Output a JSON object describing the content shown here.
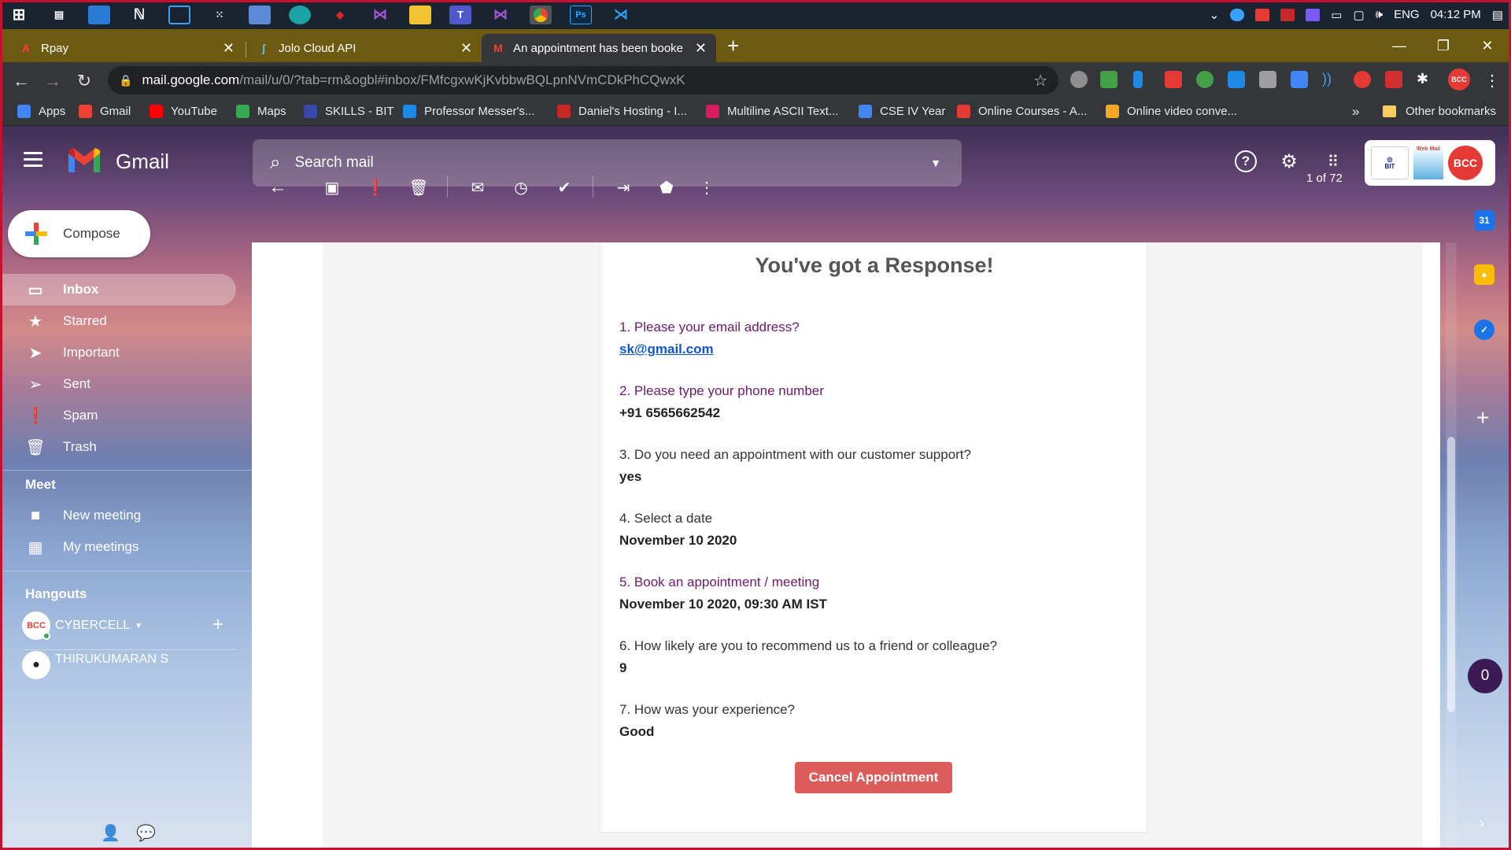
{
  "taskbar": {
    "lang": "ENG",
    "time": "04:12 PM"
  },
  "tabs": [
    {
      "title": "Rpay"
    },
    {
      "title": "Jolo Cloud API"
    },
    {
      "title": "An appointment has been booke"
    }
  ],
  "omnibox": {
    "host": "mail.google.com",
    "path": "/mail/u/0/?tab=rm&ogbl#inbox/FMfcgxwKjKvbbwBQLpnNVmCDkPhCQwxK"
  },
  "bookmarks": {
    "items": [
      {
        "label": "Apps",
        "color": "#4285f4"
      },
      {
        "label": "Gmail",
        "color": "#ea4335"
      },
      {
        "label": "YouTube",
        "color": "#ff0000"
      },
      {
        "label": "Maps",
        "color": "#34a853"
      },
      {
        "label": "SKILLS - BIT",
        "color": "#3949ab"
      },
      {
        "label": "Professor Messer's...",
        "color": "#1e88e5"
      },
      {
        "label": "Daniel's Hosting - I...",
        "color": "#c62828"
      },
      {
        "label": "Multiline ASCII Text...",
        "color": "#d81b60"
      },
      {
        "label": "CSE IV Year",
        "color": "#4285f4"
      },
      {
        "label": "Online Courses - A...",
        "color": "#e53935"
      },
      {
        "label": "Online video conve...",
        "color": "#f9a825"
      }
    ],
    "more": "»",
    "other": "Other bookmarks"
  },
  "gmail": {
    "product_name": "Gmail",
    "search_placeholder": "Search mail",
    "compose": "Compose",
    "nav": [
      {
        "label": "Inbox",
        "icon": "inbox-icon"
      },
      {
        "label": "Starred",
        "icon": "star-icon"
      },
      {
        "label": "Important",
        "icon": "important-icon"
      },
      {
        "label": "Sent",
        "icon": "send-icon"
      },
      {
        "label": "Spam",
        "icon": "spam-icon"
      },
      {
        "label": "Trash",
        "icon": "trash-icon"
      }
    ],
    "meet": {
      "title": "Meet",
      "items": [
        {
          "label": "New meeting"
        },
        {
          "label": "My meetings"
        }
      ]
    },
    "hangouts": {
      "title": "Hangouts",
      "self_name": "CYBERCELL",
      "contact": "THIRUKUMARAN S"
    },
    "pager": "1 of 72",
    "account": {
      "logo_text": "BCC",
      "webmail": "Web Mail"
    }
  },
  "email": {
    "heading": "You've got a Response!",
    "qa": [
      {
        "q": "1. Please your email address?",
        "a": "sk@gmail.com",
        "purple": true,
        "link": true
      },
      {
        "q": "2. Please type your phone number",
        "a": "+91 6565662542",
        "purple": true,
        "link": false
      },
      {
        "q": "3. Do you need an appointment with our customer support?",
        "a": "yes",
        "purple": false,
        "link": false
      },
      {
        "q": "4. Select a date",
        "a": "November 10 2020",
        "purple": false,
        "link": false
      },
      {
        "q": "5. Book an appointment / meeting",
        "a": "November 10 2020, 09:30 AM IST",
        "purple": true,
        "link": false
      },
      {
        "q": "6. How likely are you to recommend us to a friend or colleague?",
        "a": "9",
        "purple": false,
        "link": false
      },
      {
        "q": "7. How was your experience?",
        "a": "Good",
        "purple": false,
        "link": false
      }
    ],
    "cancel_button": "Cancel Appointment"
  },
  "side_panel": {
    "badge_count": "0"
  }
}
